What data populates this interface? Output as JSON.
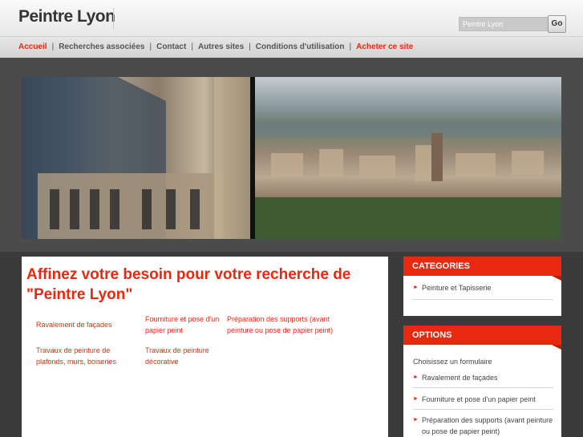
{
  "header": {
    "site_title": "Peintre Lyon",
    "search_value": "Peintre Lyon",
    "search_button": "Go"
  },
  "nav": {
    "items": [
      {
        "label": "Accueil"
      },
      {
        "label": "Recherches associées"
      },
      {
        "label": "Contact"
      },
      {
        "label": "Autres sites"
      },
      {
        "label": "Conditions d'utilisation"
      },
      {
        "label": "Acheter ce site"
      }
    ],
    "separator": "|"
  },
  "main": {
    "heading": "Affinez votre besoin pour votre recherche de \"Peintre Lyon\"",
    "links": [
      "Ravalement de façades",
      "Fourniture et pose d'un papier peint",
      "Préparation des supports (avant peinture ou pose de papier peint)",
      "Travaux de peinture de plafonds, murs, boiseries",
      "Travaux de peinture décorative"
    ]
  },
  "sidebar": {
    "categories": {
      "title": "CATEGORIES",
      "items": [
        "Peinture et Tapisserie"
      ]
    },
    "options": {
      "title": "OPTIONS",
      "intro": "Choisissez un formulaire",
      "items": [
        "Ravalement de façades",
        "Fourniture et pose d'un papier peint",
        "Préparation des supports (avant peinture ou pose de papier peint)"
      ]
    }
  },
  "colors": {
    "accent": "#e8290f",
    "background": "#3a3a3a"
  }
}
